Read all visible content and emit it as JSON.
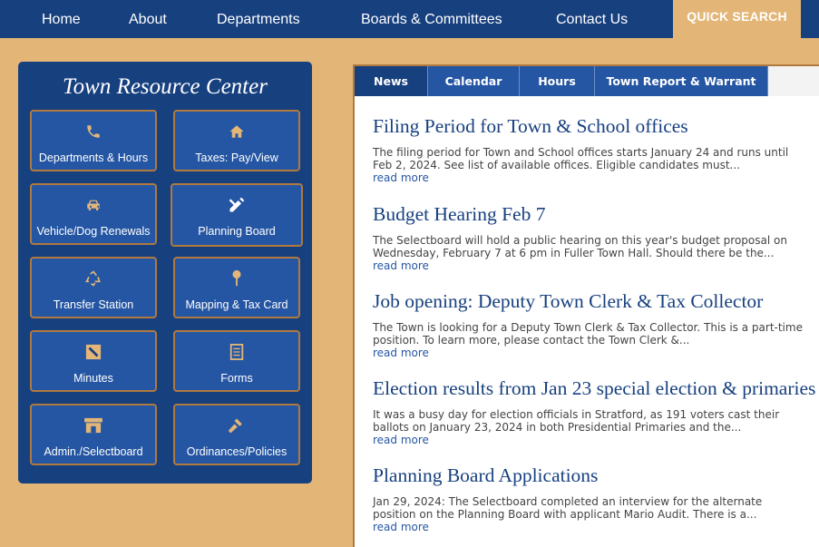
{
  "topnav": {
    "items": [
      "Home",
      "About",
      "Departments",
      "Boards & Committees",
      "Contact Us"
    ],
    "quick_search": "QUICK SEARCH"
  },
  "resource_center": {
    "title": "Town Resource Center",
    "tiles": [
      {
        "label": "Departments & Hours",
        "icon": "phone-icon"
      },
      {
        "label": "Taxes: Pay/View",
        "icon": "home-icon"
      },
      {
        "label": "Vehicle/Dog Renewals",
        "icon": "car-icon"
      },
      {
        "label": "Planning Board",
        "icon": "ruler-pencil-icon"
      },
      {
        "label": "Transfer Station",
        "icon": "recycle-icon"
      },
      {
        "label": "Mapping & Tax Card",
        "icon": "map-pin-icon"
      },
      {
        "label": "Minutes",
        "icon": "pencil-square-icon"
      },
      {
        "label": "Forms",
        "icon": "form-icon"
      },
      {
        "label": "Admin./Selectboard",
        "icon": "building-icon"
      },
      {
        "label": "Ordinances/Policies",
        "icon": "gavel-icon"
      }
    ]
  },
  "news": {
    "tabs": [
      "News",
      "Calendar",
      "Hours",
      "Town Report & Warrant"
    ],
    "active_tab": "News",
    "read_more_label": "read more",
    "articles": [
      {
        "title": "Filing Period for Town & School offices",
        "snippet": "The filing period for Town and School offices starts January 24 and runs until Feb 2, 2024. See list of available offices. Eligible candidates must..."
      },
      {
        "title": "Budget Hearing Feb 7",
        "snippet": "The Selectboard will hold a public hearing on this year's budget proposal on Wednesday, February 7 at 6 pm in Fuller Town Hall. Should there be the..."
      },
      {
        "title": "Job opening: Deputy Town Clerk & Tax Collector",
        "snippet": "The Town is looking for a Deputy Town Clerk & Tax Collector. This is a part-time position. To learn more, please contact the Town Clerk &..."
      },
      {
        "title": "Election results from Jan 23 special election & primaries",
        "snippet": "It was a busy day for election officials in Stratford, as 191 voters cast their ballots on January 23, 2024 in both Presidential Primaries and the..."
      },
      {
        "title": "Planning Board Applications",
        "snippet": "Jan 29, 2024: The Selectboard completed an interview for the alternate position on the Planning Board with applicant Mario Audit. There is a..."
      }
    ]
  },
  "colors": {
    "navy": "#17407f",
    "tile_blue": "#2556a3",
    "tan": "#e3b678",
    "gold_border": "#b07a3f"
  }
}
